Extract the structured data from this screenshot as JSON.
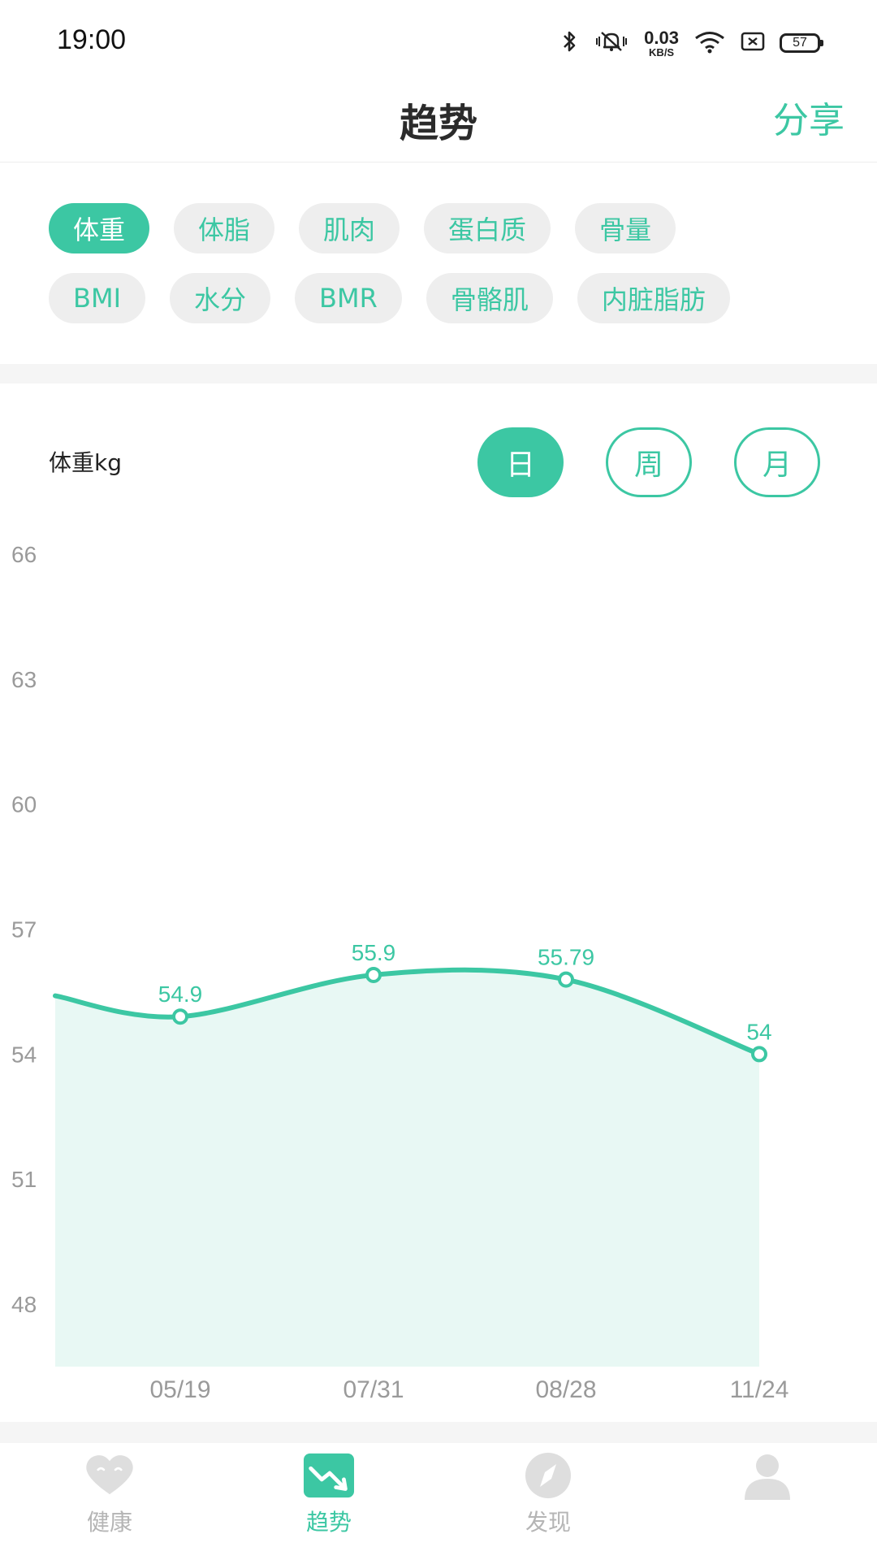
{
  "status": {
    "time": "19:00",
    "net_speed_value": "0.03",
    "net_speed_unit": "KB/S",
    "battery": "57"
  },
  "header": {
    "title": "趋势",
    "share_label": "分享"
  },
  "chips": {
    "row1": [
      "体重",
      "体脂",
      "肌肉",
      "蛋白质",
      "骨量"
    ],
    "row2": [
      "BMI",
      "水分",
      "BMR",
      "骨骼肌",
      "内脏脂肪"
    ],
    "active": "体重"
  },
  "chart_header": {
    "label": "体重kg",
    "periods": [
      "日",
      "周",
      "月"
    ],
    "active_period": "日"
  },
  "colors": {
    "accent": "#3cc7a3",
    "fill": "#e8f8f4",
    "axis_text": "#9a9a9a"
  },
  "chart_data": {
    "type": "area",
    "ylabel": "体重kg",
    "ylim": [
      46.5,
      66
    ],
    "yticks": [
      66,
      63,
      60,
      57,
      54,
      51,
      48
    ],
    "categories": [
      "05/19",
      "07/31",
      "08/28",
      "11/24"
    ],
    "series": [
      {
        "values": [
          54.9,
          55.9,
          55.79,
          54
        ],
        "labels": [
          "54.9",
          "55.9",
          "55.79",
          "54"
        ]
      }
    ],
    "leading_value": 55.4,
    "grid": false
  },
  "tabs": [
    {
      "label": "健康",
      "icon": "heart-icon"
    },
    {
      "label": "趋势",
      "icon": "trend-icon"
    },
    {
      "label": "发现",
      "icon": "compass-icon"
    },
    {
      "label": "",
      "icon": "profile-icon"
    }
  ],
  "active_tab": 1
}
